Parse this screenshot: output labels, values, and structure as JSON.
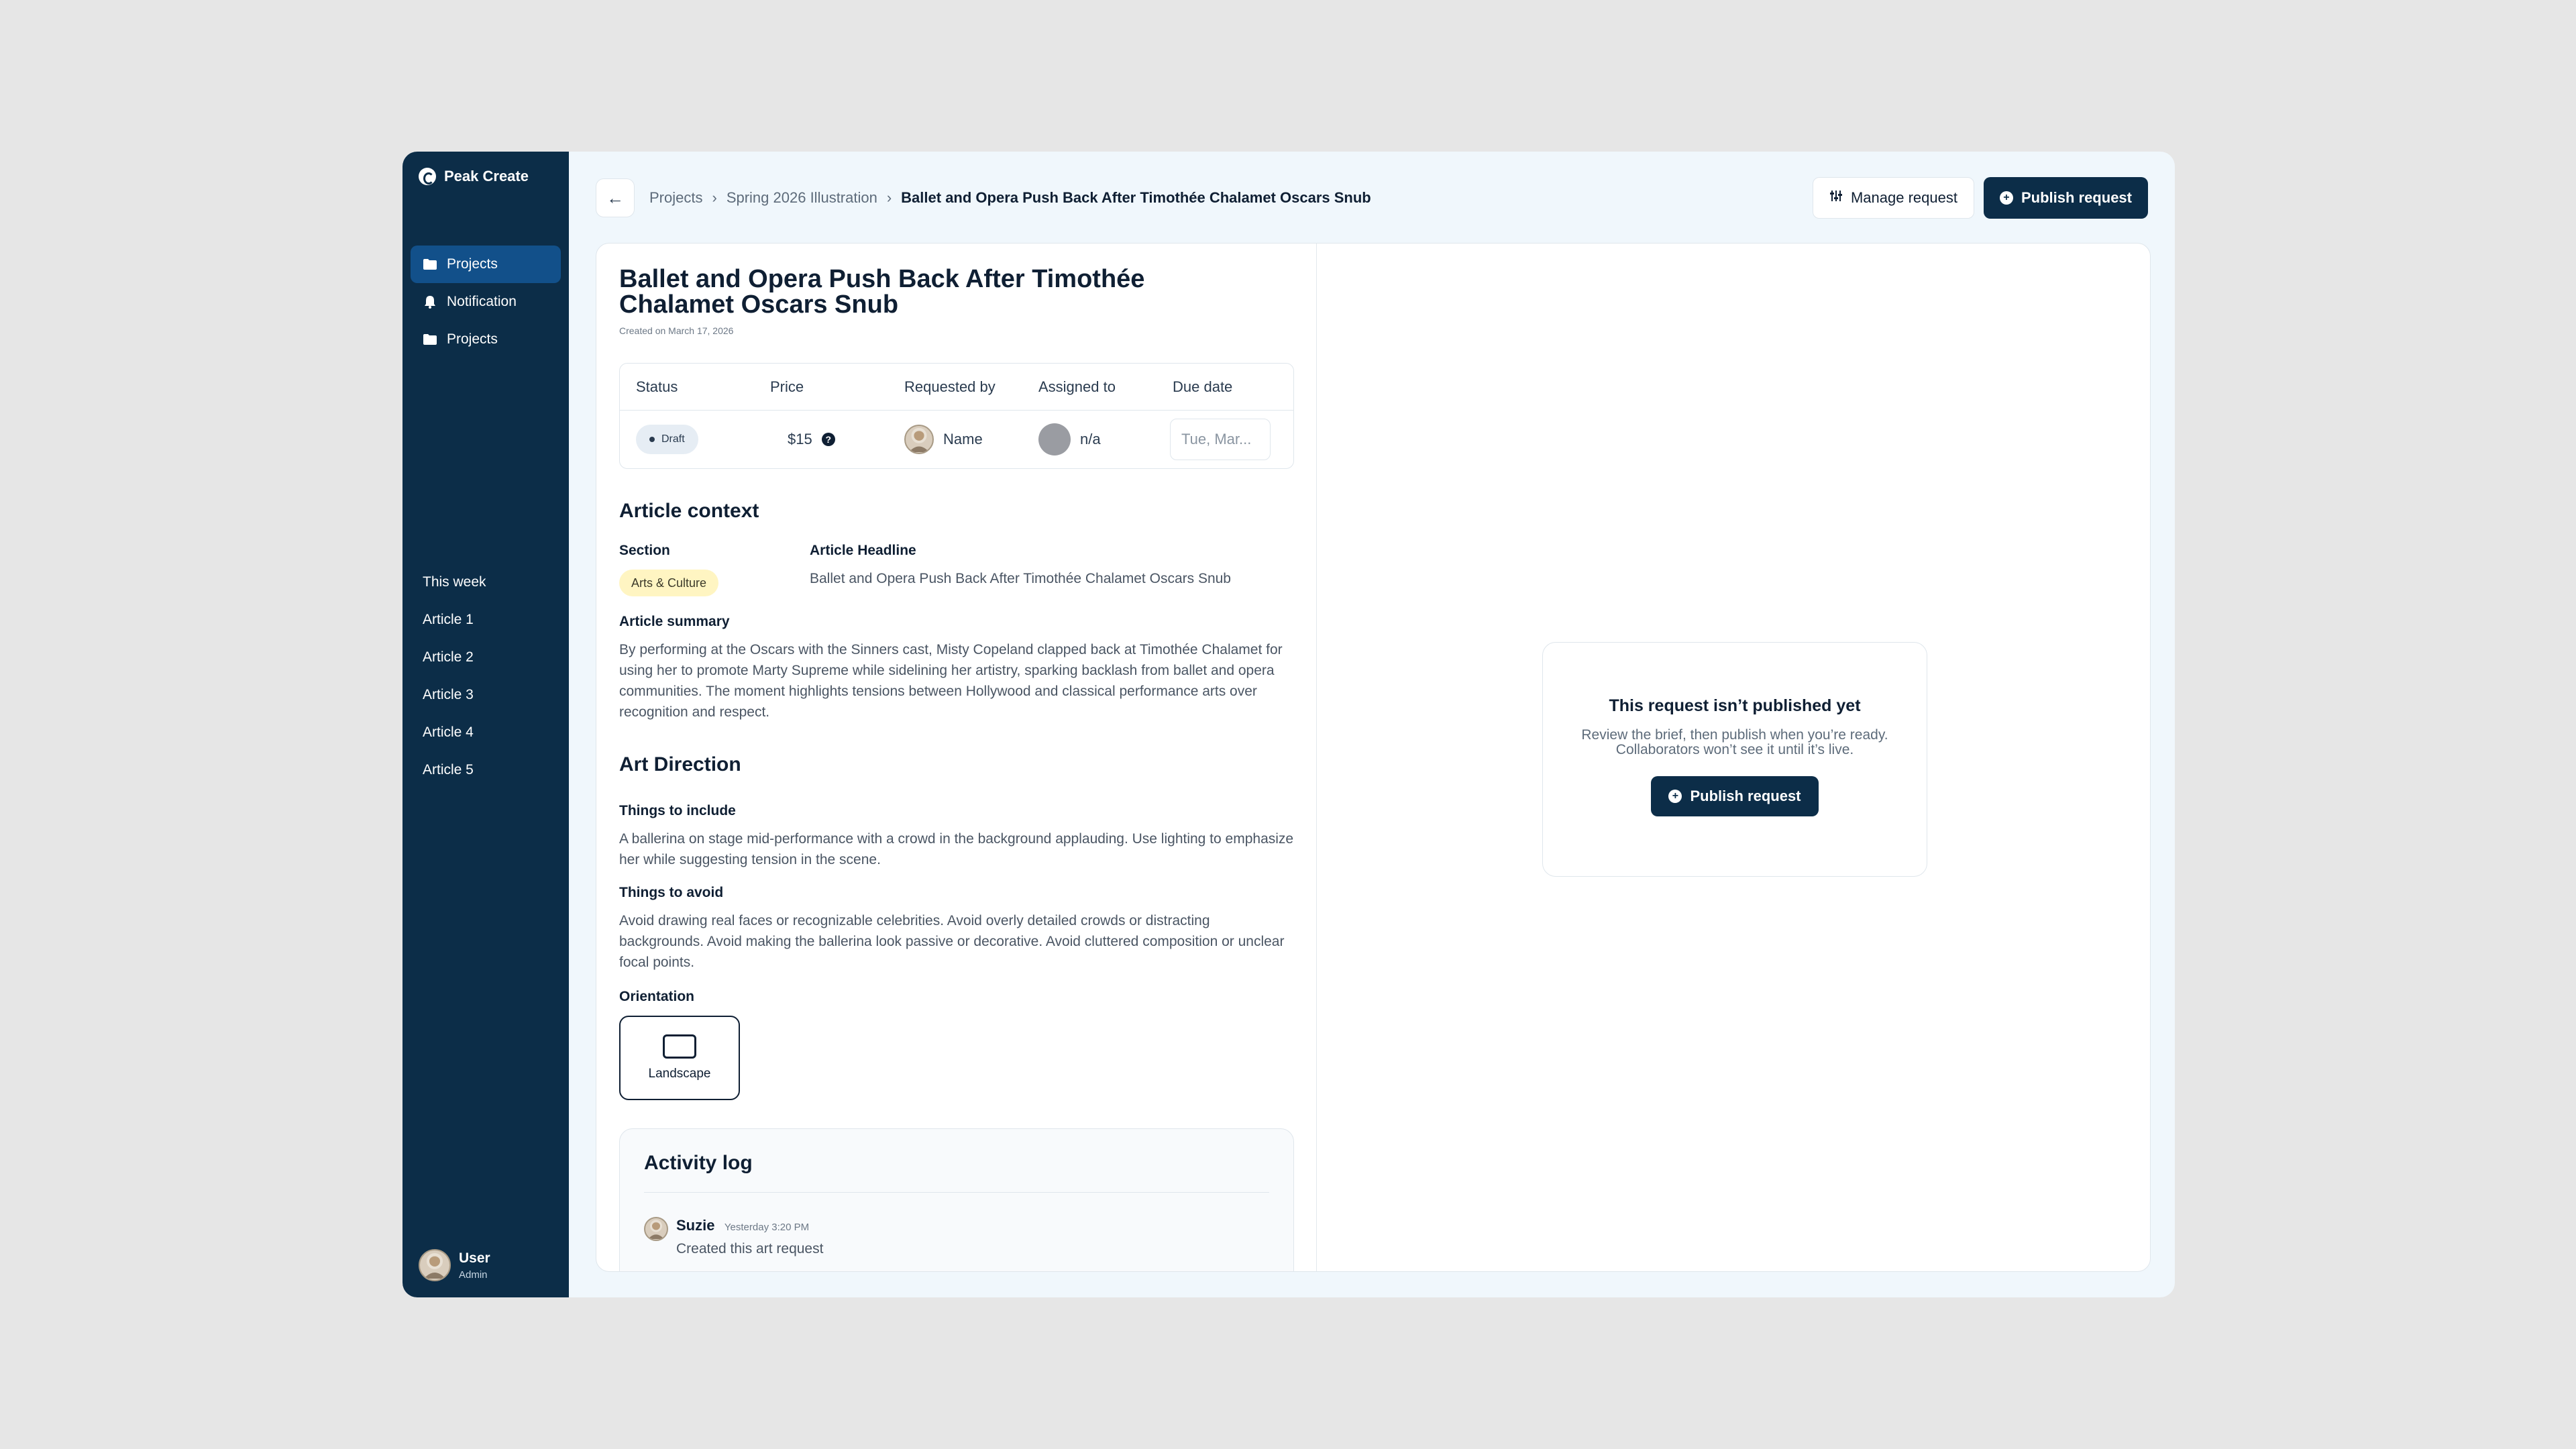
{
  "brand": {
    "name": "Peak Create"
  },
  "sidebar": {
    "nav": [
      {
        "label": "Projects",
        "icon": "folder-icon",
        "active": true
      },
      {
        "label": "Notification",
        "icon": "bell-icon",
        "active": false
      },
      {
        "label": "Projects",
        "icon": "folder-icon",
        "active": false
      }
    ],
    "weeks": [
      "This week",
      "Article 1",
      "Article 2",
      "Article 3",
      "Article 4",
      "Article 5"
    ],
    "user": {
      "name": "User",
      "role": "Admin"
    }
  },
  "topbar": {
    "breadcrumbs": [
      "Projects",
      "Spring 2026 Illustration",
      "Ballet and Opera Push Back After Timothée Chalamet Oscars Snub"
    ],
    "manage_label": "Manage request",
    "publish_label": "Publish request"
  },
  "request": {
    "title": "Ballet and Opera Push Back After Timothée Chalamet Oscars Snub",
    "created": "Created on March 17, 2026",
    "table": {
      "headers": [
        "Status",
        "Price",
        "Requested by",
        "Assigned to",
        "Due date"
      ],
      "status": "Draft",
      "price": "$15",
      "requested_by": "Name",
      "assigned_to": "n/a",
      "due_placeholder": "Tue, Mar..."
    }
  },
  "context": {
    "title": "Article context",
    "section_label": "Section",
    "section_value": "Arts & Culture",
    "headline_label": "Article Headline",
    "headline_value": "Ballet and Opera Push Back After Timothée Chalamet Oscars Snub",
    "summary_label": "Article summary",
    "summary_text": "By performing at the Oscars with the Sinners cast, Misty Copeland clapped back at Timothée Chalamet for using her to promote Marty Supreme while sidelining her artistry, sparking backlash from ballet and opera communities. The moment highlights tensions between Hollywood and classical performance arts over recognition and respect."
  },
  "art_direction": {
    "title": "Art Direction",
    "include_label": "Things to include",
    "include_text": "A ballerina on stage mid-performance with a crowd in the background applauding. Use lighting to emphasize her while suggesting tension in the scene.",
    "avoid_label": "Things to avoid",
    "avoid_text": "Avoid drawing real faces or recognizable celebrities. Avoid overly detailed crowds or distracting backgrounds. Avoid making the ballerina look passive or decorative. Avoid cluttered composition or unclear focal points.",
    "orientation_label": "Orientation",
    "orientation_value": "Landscape"
  },
  "activity": {
    "title": "Activity log",
    "entries": [
      {
        "name": "Suzie",
        "time": "Yesterday 3:20 PM",
        "text": "Created this art request"
      }
    ]
  },
  "empty_state": {
    "title": "This request isn’t published yet",
    "subtitle": "Review the brief, then publish when you’re ready. Collaborators won’t see it until it’s live.",
    "button_label": "Publish request"
  },
  "colors": {
    "sidebar": "#0c2d48",
    "active_nav": "#12508a",
    "tag_bg": "#fff5c2"
  }
}
